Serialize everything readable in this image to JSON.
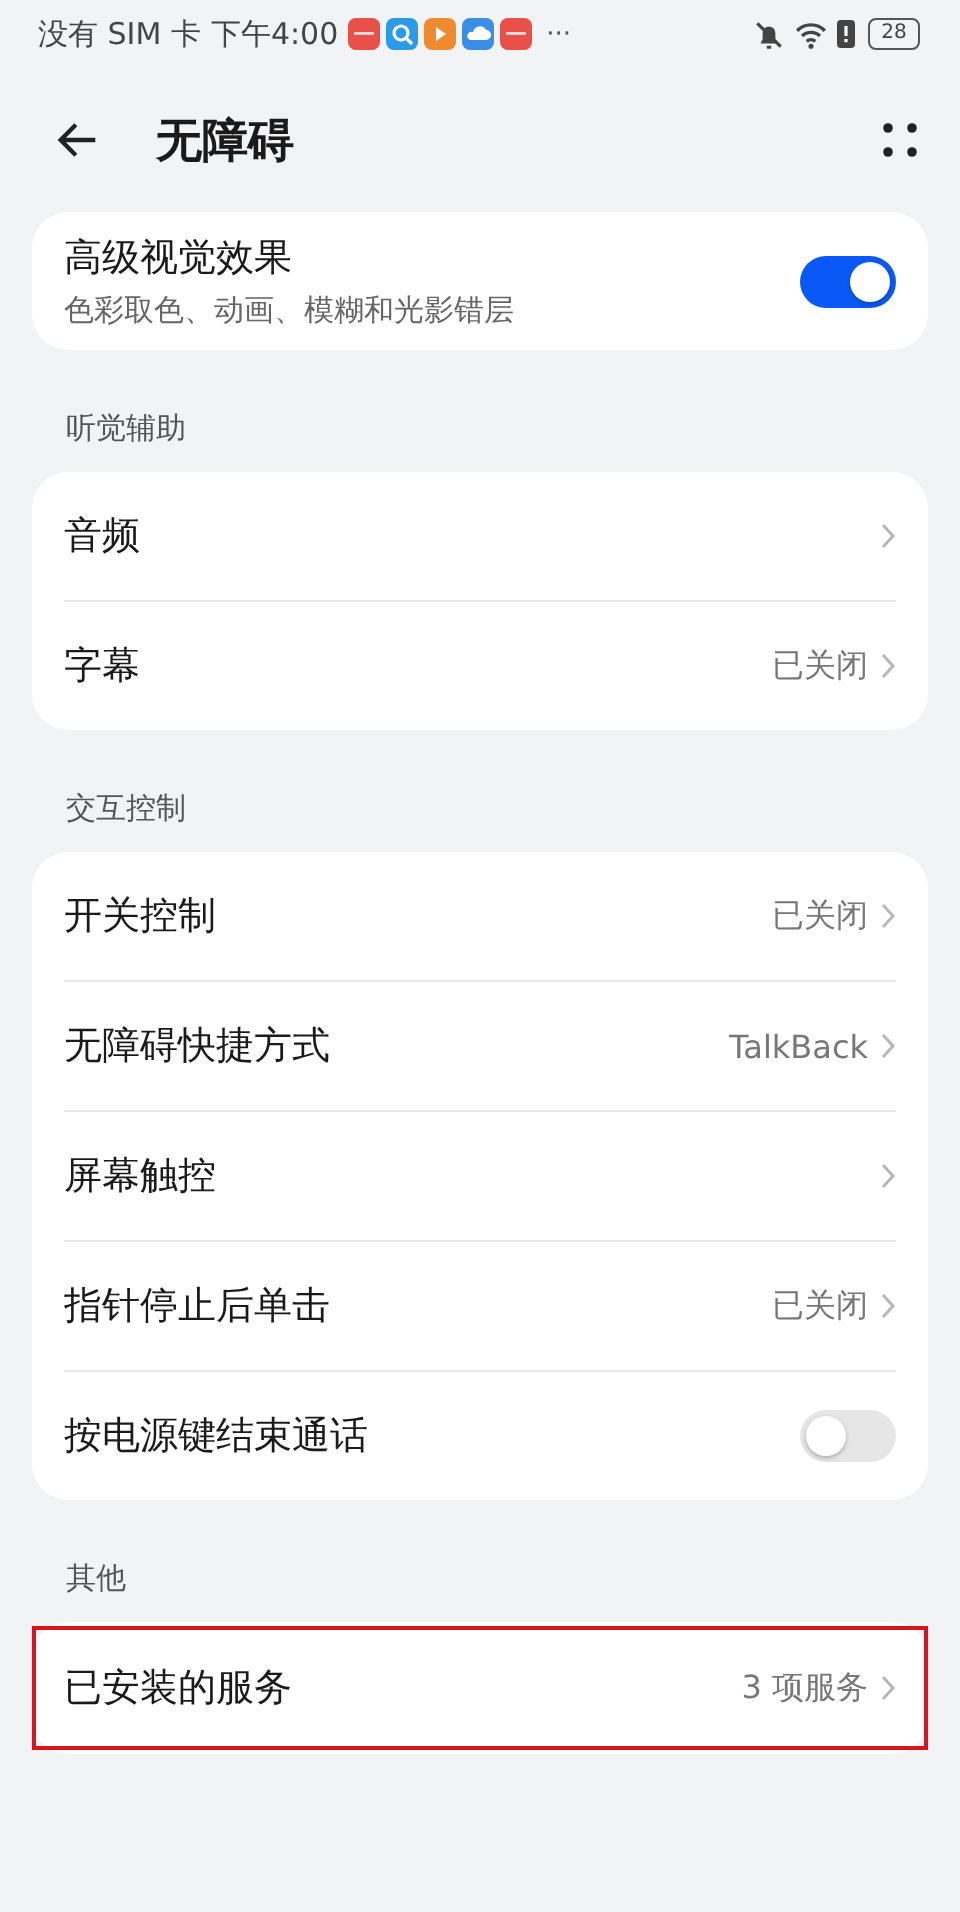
{
  "status_bar": {
    "carrier": "没有 SIM 卡",
    "time": "下午4:00",
    "more": "···",
    "battery": "28"
  },
  "header": {
    "title": "无障碍"
  },
  "groups": [
    {
      "rows": [
        {
          "kind": "toggle",
          "title": "高级视觉效果",
          "subtitle": "色彩取色、动画、模糊和光影错层",
          "on": true,
          "highlighted": false
        }
      ]
    },
    {
      "label": "听觉辅助",
      "rows": [
        {
          "kind": "link",
          "title": "音频",
          "highlighted": false
        },
        {
          "kind": "link",
          "title": "字幕",
          "value": "已关闭",
          "highlighted": false
        }
      ]
    },
    {
      "label": "交互控制",
      "rows": [
        {
          "kind": "link",
          "title": "开关控制",
          "value": "已关闭",
          "highlighted": false
        },
        {
          "kind": "link",
          "title": "无障碍快捷方式",
          "value": "TalkBack",
          "highlighted": false
        },
        {
          "kind": "link",
          "title": "屏幕触控",
          "highlighted": false
        },
        {
          "kind": "link",
          "title": "指针停止后单击",
          "value": "已关闭",
          "highlighted": false
        },
        {
          "kind": "toggle",
          "title": "按电源键结束通话",
          "on": false,
          "highlighted": false
        }
      ]
    },
    {
      "label": "其他",
      "rows": [
        {
          "kind": "link",
          "title": "已安装的服务",
          "value": "3 项服务",
          "highlighted": true
        }
      ]
    }
  ]
}
